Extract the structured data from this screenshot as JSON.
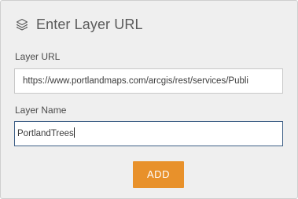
{
  "dialog": {
    "title": "Enter Layer URL",
    "title_icon": "layers-icon"
  },
  "layer_url": {
    "label": "Layer URL",
    "value": "https://www.portlandmaps.com/arcgis/rest/services/Publi"
  },
  "layer_name": {
    "label": "Layer Name",
    "value": "PortlandTrees"
  },
  "actions": {
    "add_label": "ADD",
    "add_color": "#e8912b"
  },
  "colors": {
    "panel_background": "#efefef",
    "focused_border": "#3e5f86"
  }
}
